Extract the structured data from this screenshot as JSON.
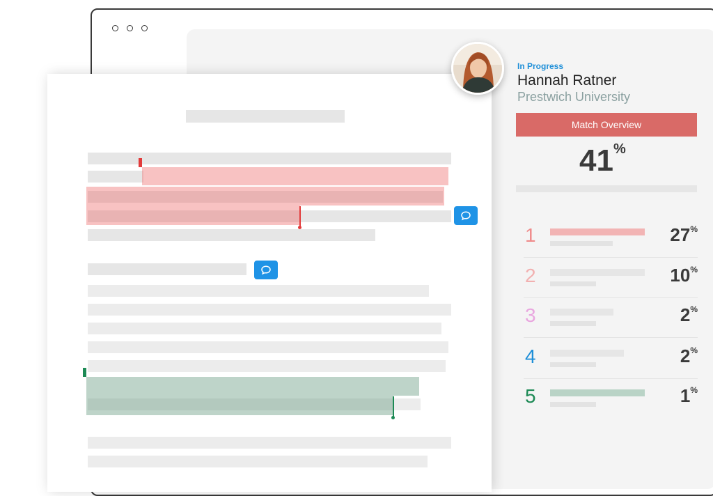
{
  "window": {
    "controls": [
      "dot",
      "dot",
      "dot"
    ]
  },
  "profile": {
    "status": "In Progress",
    "name": "Hannah Ratner",
    "school": "Prestwich University"
  },
  "match": {
    "button_label": "Match Overview",
    "overall_value": "41",
    "overall_unit": "%"
  },
  "sources": [
    {
      "rank": "1",
      "percent": "27",
      "unit": "%",
      "color": "#ef8b8b",
      "bar_color": "#f2b4b4",
      "fill": 0.9
    },
    {
      "rank": "2",
      "percent": "10",
      "unit": "%",
      "color": "#f2b0b0",
      "bar_color": "#e6e6e6",
      "fill": 0.9
    },
    {
      "rank": "3",
      "percent": "2",
      "unit": "%",
      "color": "#e9a6df",
      "bar_color": "#e6e6e6",
      "fill": 0.6
    },
    {
      "rank": "4",
      "percent": "2",
      "unit": "%",
      "color": "#1f8fd8",
      "bar_color": "#e6e6e6",
      "fill": 0.7
    },
    {
      "rank": "5",
      "percent": "1",
      "unit": "%",
      "color": "#1d8a55",
      "bar_color": "#b9d3c6",
      "fill": 0.9
    }
  ],
  "colors": {
    "accent_blue": "#1f93e6",
    "match_red": "#d96a67",
    "highlight_red": "#ee6e6e",
    "highlight_green": "#6ea087"
  }
}
